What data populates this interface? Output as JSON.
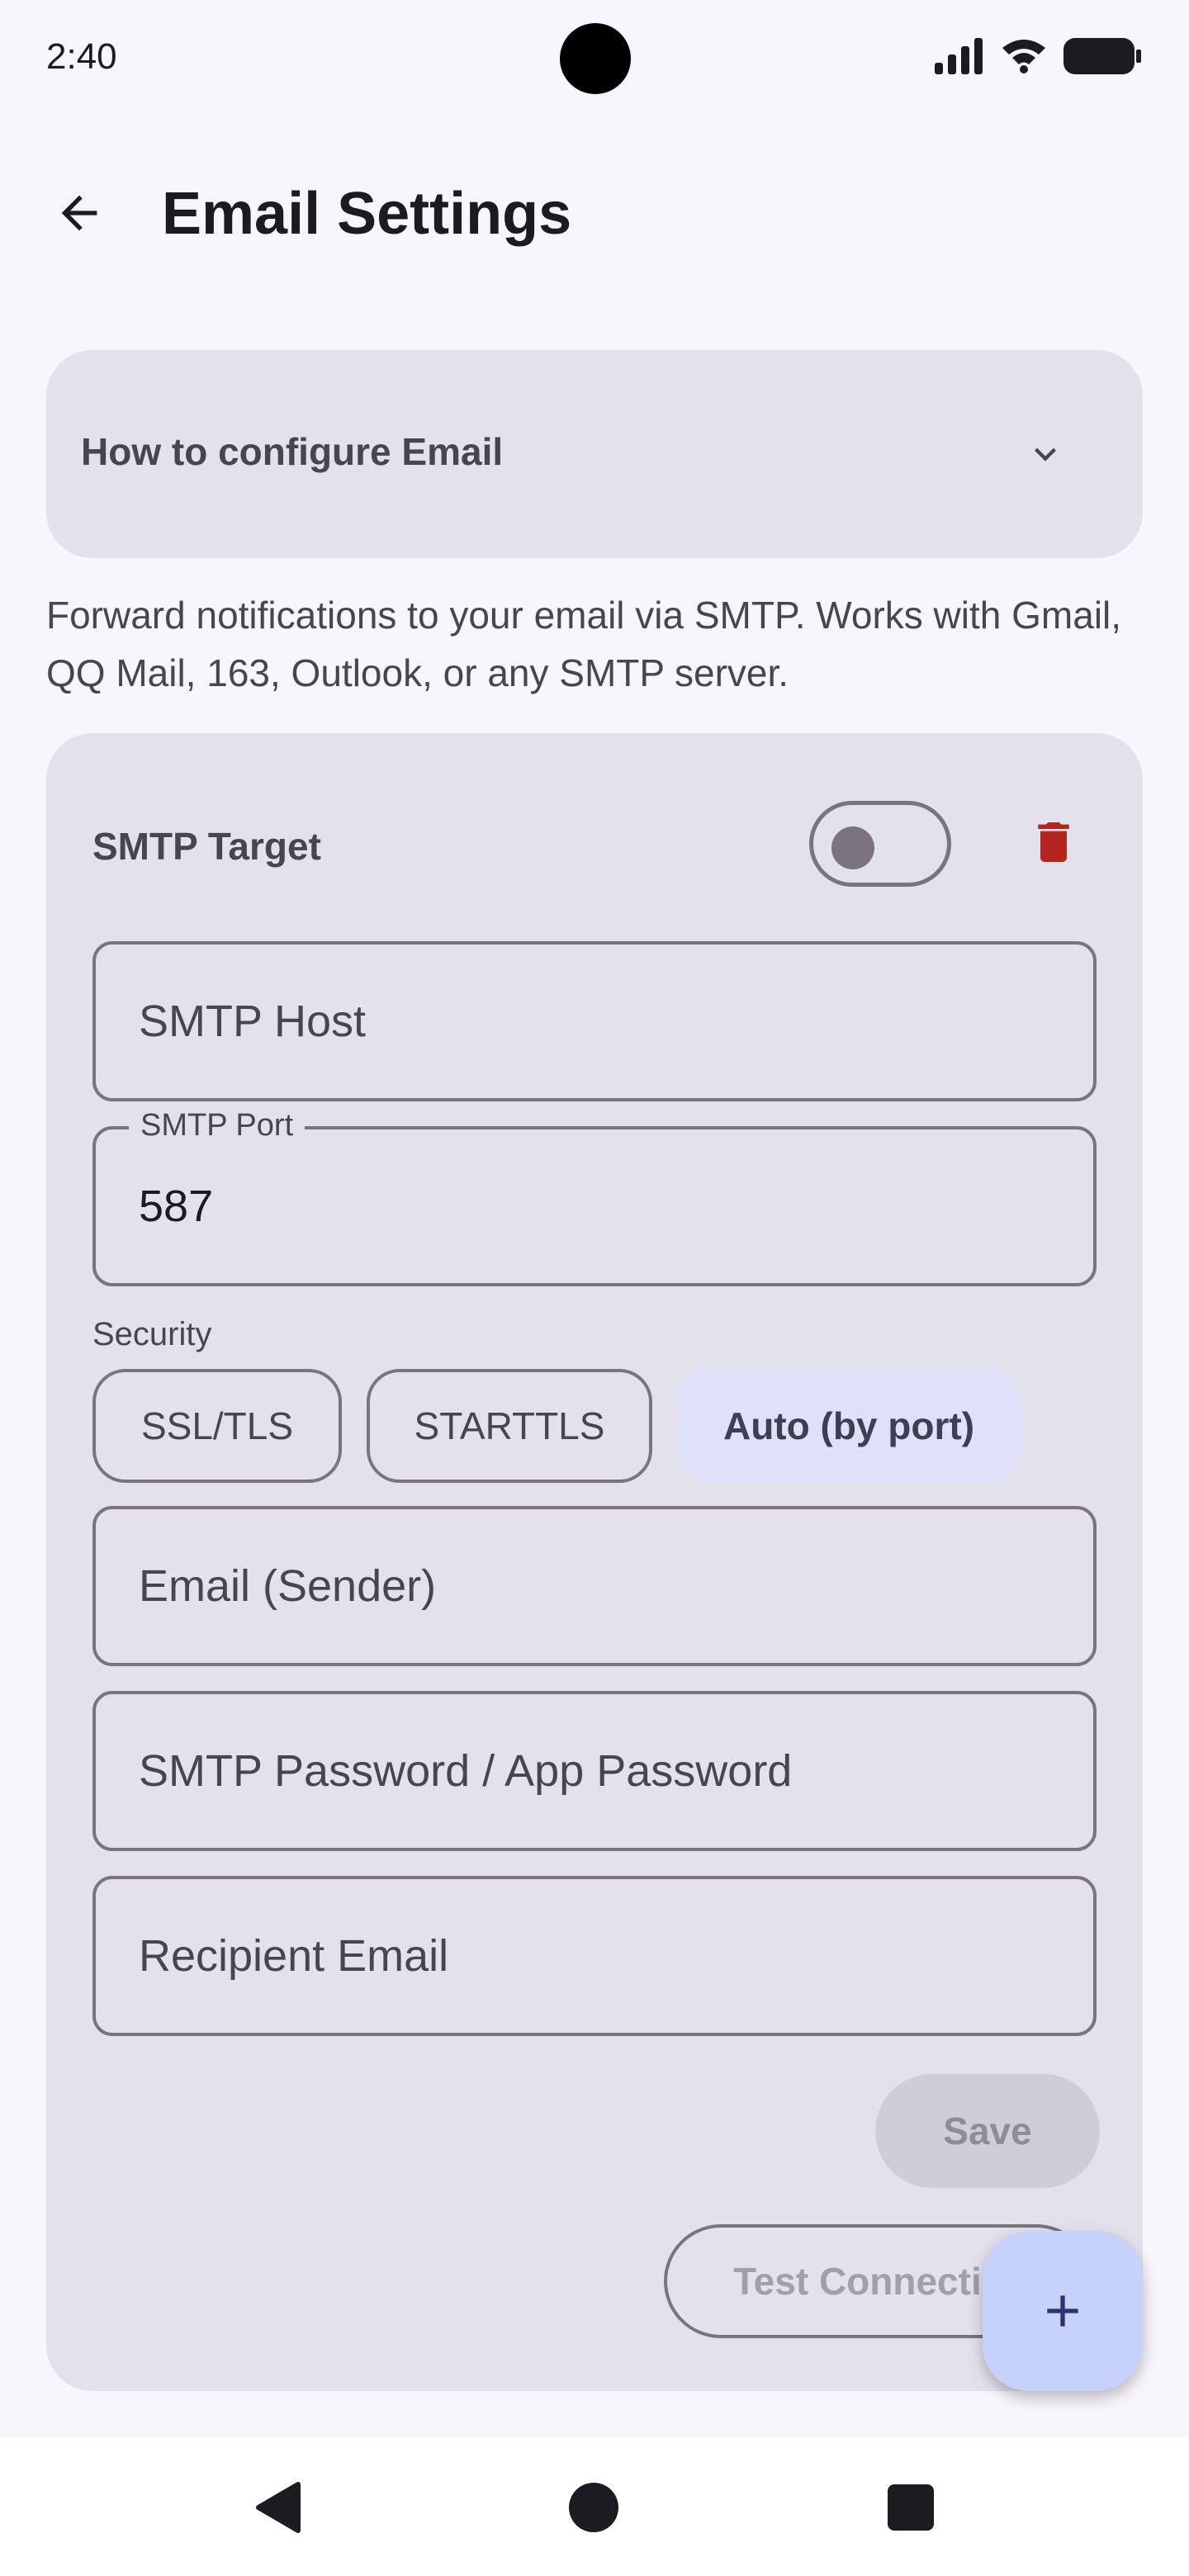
{
  "status_bar": {
    "time": "2:40"
  },
  "app_bar": {
    "title": "Email Settings"
  },
  "help": {
    "title": "How to configure Email"
  },
  "description": "Forward notifications to your email via SMTP. Works with Gmail, QQ Mail, 163, Outlook, or any SMTP server.",
  "target": {
    "title": "SMTP Target",
    "enabled": false,
    "fields": {
      "host": {
        "placeholder": "SMTP Host",
        "value": ""
      },
      "port": {
        "label": "SMTP Port",
        "value": "587"
      },
      "sender": {
        "placeholder": "Email (Sender)",
        "value": ""
      },
      "password": {
        "placeholder": "SMTP Password / App Password",
        "value": ""
      },
      "recipient": {
        "placeholder": "Recipient Email",
        "value": ""
      }
    },
    "security": {
      "label": "Security",
      "options": [
        "SSL/TLS",
        "STARTTLS",
        "Auto (by port)"
      ],
      "selected": "Auto (by port)"
    },
    "save_label": "Save",
    "test_label": "Test Connection"
  },
  "colors": {
    "delete": "#b3261e",
    "fab": "#c7d2fb",
    "card": "#e3e1ec",
    "background": "#f8f5fc"
  },
  "icons": {
    "back": "arrow-left-icon",
    "expand": "chevron-down-icon",
    "delete": "trash-icon",
    "fab": "plus-icon",
    "nav": [
      "back-triangle-icon",
      "home-circle-icon",
      "recents-square-icon"
    ]
  }
}
